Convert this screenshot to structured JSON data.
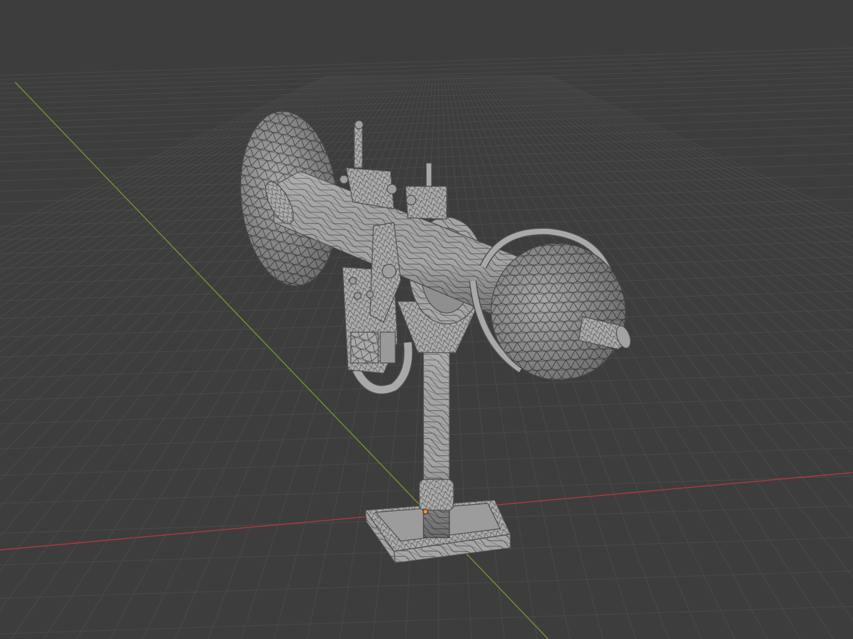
{
  "viewport": {
    "background_color": "#3d3d3d",
    "grid_color": "#4a4a4a",
    "x_axis_color": "#b0393e",
    "y_axis_color": "#6e9a2c",
    "mesh_fill_color": "#a9a9a9",
    "wire_color": "#4d4d4d",
    "origin_color": "#ff8c1a",
    "object": {
      "icon": "wireframe-mesh-icon",
      "shading": "solid-with-wireframe-overlay"
    }
  }
}
